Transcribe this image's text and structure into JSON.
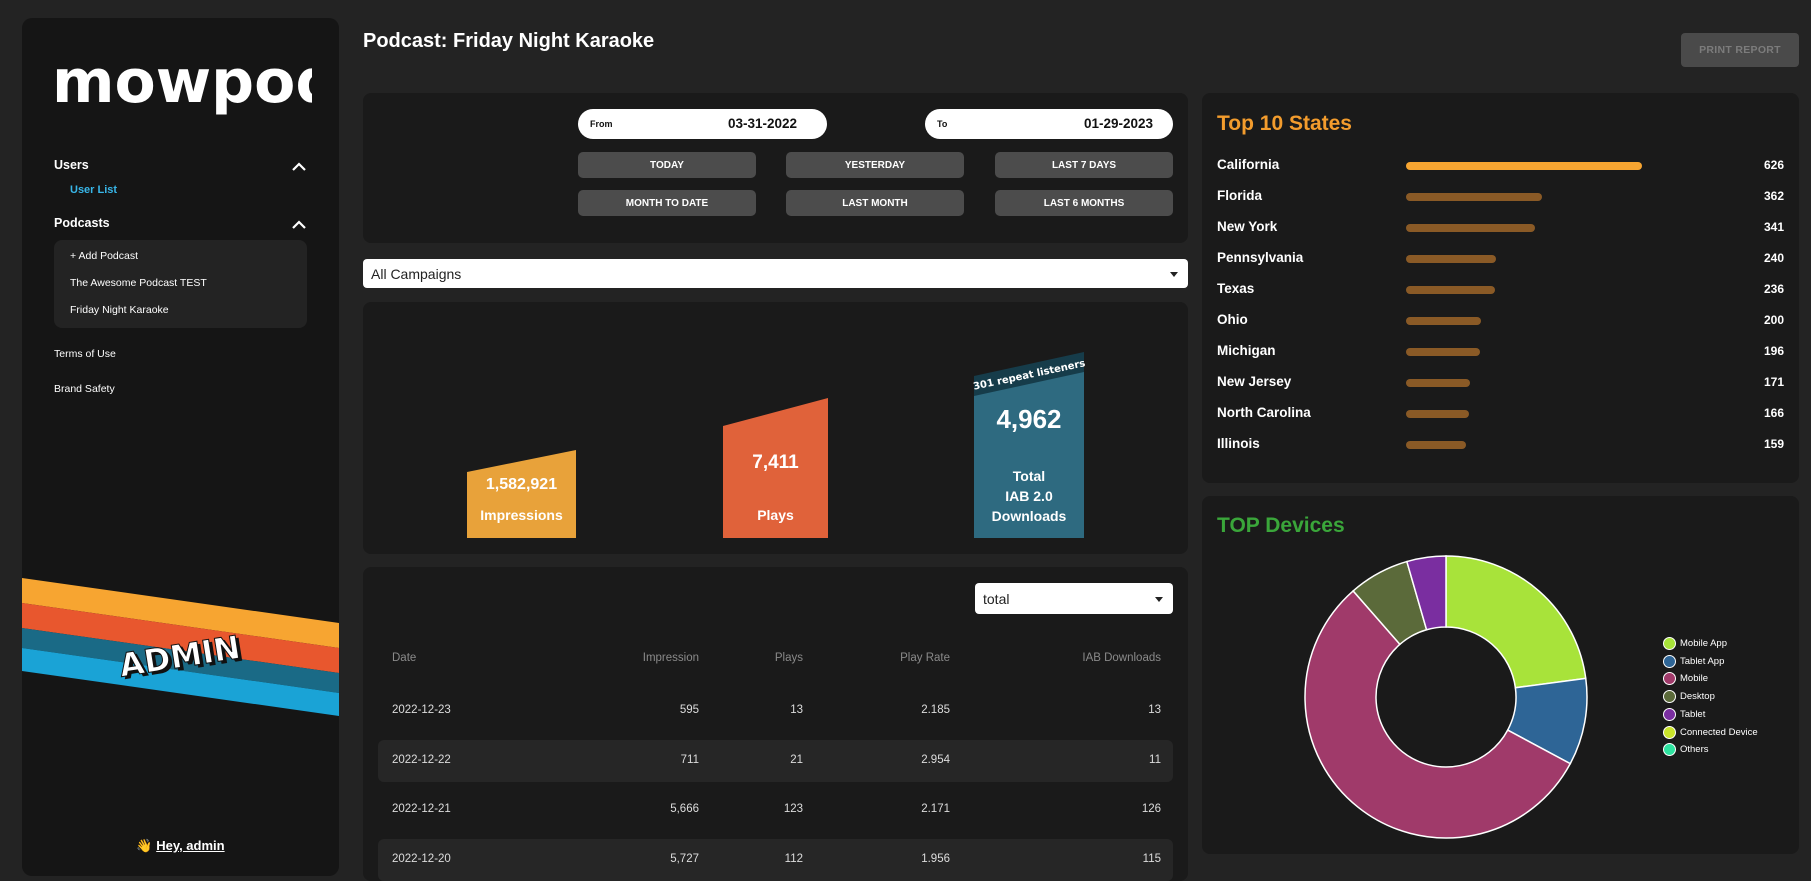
{
  "sidebar": {
    "logo": "mowpod",
    "users_label": "Users",
    "user_list_label": "User List",
    "podcasts_label": "Podcasts",
    "podcast_items": [
      "+ Add Podcast",
      "The Awesome Podcast TEST",
      "Friday Night Karaoke"
    ],
    "terms_label": "Terms of Use",
    "brand_safety_label": "Brand Safety",
    "admin_badge": "ADMIN",
    "greeting_emoji": "👋",
    "greeting": "Hey, admin",
    "accent_color": "#38b6e8"
  },
  "header": {
    "title": "Podcast: Friday Night Karaoke",
    "print_label": "PRINT REPORT"
  },
  "dates": {
    "from_label": "From",
    "from_value": "03-31-2022",
    "to_label": "To",
    "to_value": "01-29-2023",
    "quick": [
      "TODAY",
      "YESTERDAY",
      "LAST 7 DAYS",
      "MONTH TO DATE",
      "LAST MONTH",
      "LAST 6 MONTHS"
    ]
  },
  "campaign_select": "All Campaigns",
  "funnel": {
    "impressions_value": "1,582,921",
    "impressions_label": "Impressions",
    "plays_value": "7,411",
    "plays_label": "Plays",
    "downloads_value": "4,962",
    "downloads_label_1": "Total",
    "downloads_label_2": "IAB 2.0",
    "downloads_label_3": "Downloads",
    "repeat_listeners": "301 repeat listeners",
    "colors": {
      "impressions": "#e8a23a",
      "plays": "#e0623a",
      "downloads": "#2e6a80"
    }
  },
  "table": {
    "metric_select": "total",
    "headers": [
      "Date",
      "Impression",
      "Plays",
      "Play Rate",
      "IAB Downloads"
    ],
    "rows": [
      [
        "2022-12-23",
        "595",
        "13",
        "2.185",
        "13"
      ],
      [
        "2022-12-22",
        "711",
        "21",
        "2.954",
        "11"
      ],
      [
        "2022-12-21",
        "5,666",
        "123",
        "2.171",
        "126"
      ],
      [
        "2022-12-20",
        "5,727",
        "112",
        "1.956",
        "115"
      ]
    ]
  },
  "states": {
    "title": "Top 10 States",
    "max": 626,
    "items": [
      {
        "name": "California",
        "value": 626
      },
      {
        "name": "Florida",
        "value": 362
      },
      {
        "name": "New York",
        "value": 341
      },
      {
        "name": "Pennsylvania",
        "value": 240
      },
      {
        "name": "Texas",
        "value": 236
      },
      {
        "name": "Ohio",
        "value": 200
      },
      {
        "name": "Michigan",
        "value": 196
      },
      {
        "name": "New Jersey",
        "value": 171
      },
      {
        "name": "North Carolina",
        "value": 166
      },
      {
        "name": "Illinois",
        "value": 159
      }
    ],
    "top_color": "#f7a531",
    "bar_color": "#8a5a26"
  },
  "devices": {
    "title": "TOP Devices",
    "legend": [
      {
        "label": "Mobile App",
        "color": "#a8e33a"
      },
      {
        "label": "Tablet App",
        "color": "#2e6596"
      },
      {
        "label": "Mobile",
        "color": "#a03a6a"
      },
      {
        "label": "Desktop",
        "color": "#5b6a3a"
      },
      {
        "label": "Tablet",
        "color": "#7a2ea0"
      },
      {
        "label": "Connected Device",
        "color": "#c8e32a"
      },
      {
        "label": "Others",
        "color": "#2ee3a0"
      }
    ]
  },
  "chart_data": {
    "type": "pie",
    "categories": [
      "Mobile App",
      "Tablet App",
      "Mobile",
      "Desktop",
      "Tablet",
      "Connected Device",
      "Others"
    ],
    "values": [
      23,
      10,
      56,
      7,
      4.5,
      0,
      0
    ],
    "legend_position": "right"
  }
}
